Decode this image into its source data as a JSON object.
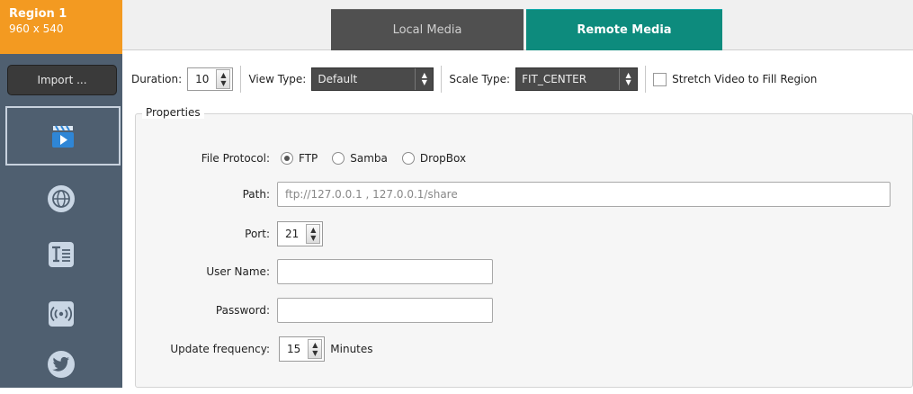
{
  "region": {
    "title": "Region 1",
    "size": "960 x 540"
  },
  "sidebar": {
    "import_label": "Import ...",
    "icons": [
      "video-clip-icon",
      "globe-icon",
      "text-icon",
      "broadcast-icon",
      "twitter-icon"
    ]
  },
  "tabs": [
    {
      "label": "Local Media",
      "active": false
    },
    {
      "label": "Remote Media",
      "active": true
    }
  ],
  "toolbar": {
    "duration_label": "Duration:",
    "duration_value": "10",
    "view_type_label": "View Type:",
    "view_type_value": "Default",
    "scale_type_label": "Scale Type:",
    "scale_type_value": "FIT_CENTER",
    "stretch_label": "Stretch Video to Fill Region",
    "stretch_checked": false
  },
  "properties": {
    "title": "Properties",
    "file_protocol_label": "File Protocol:",
    "protocols": [
      {
        "label": "FTP",
        "selected": true
      },
      {
        "label": "Samba",
        "selected": false
      },
      {
        "label": "DropBox",
        "selected": false
      }
    ],
    "path_label": "Path:",
    "path_placeholder": "ftp://127.0.0.1 , 127.0.0.1/share",
    "port_label": "Port:",
    "port_value": "21",
    "username_label": "User Name:",
    "username_value": "",
    "password_label": "Password:",
    "password_value": "",
    "update_label": "Update frequency:",
    "update_value": "15",
    "update_unit": "Minutes"
  },
  "colors": {
    "region_accent": "#f39a21",
    "active_tab": "#0d8b7d",
    "sidebar_bg": "#4f5f70"
  }
}
